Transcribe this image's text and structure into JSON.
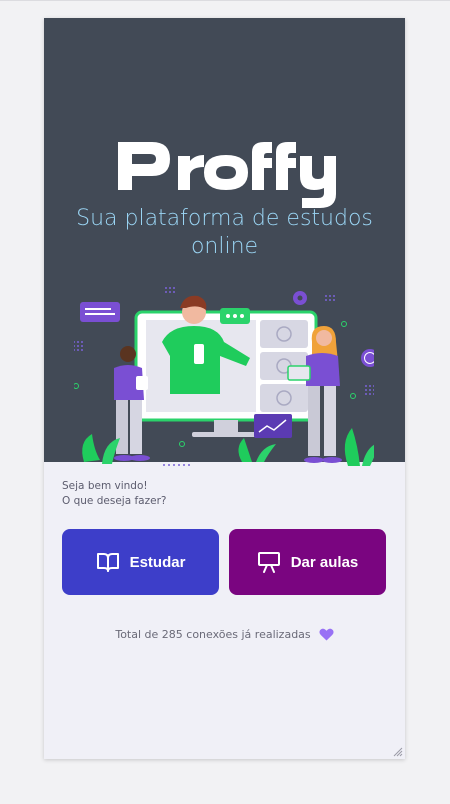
{
  "app": {
    "logo_text": "Proffy",
    "tagline_line1": "Sua plataforma de estudos",
    "tagline_line2": "online"
  },
  "welcome": {
    "line1": "Seja bem vindo!",
    "line2": "O que deseja fazer?"
  },
  "actions": {
    "study_label": "Estudar",
    "study_icon": "book-open-icon",
    "teach_label": "Dar aulas",
    "teach_icon": "presentation-icon"
  },
  "footer": {
    "total_text": "Total de 285 conexões já realizadas",
    "heart_icon": "heart-icon"
  },
  "colors": {
    "hero_bg": "#424a56",
    "tagline": "#9bd6f5",
    "study_button": "#3d3ec9",
    "teach_button": "#7a0580",
    "heart": "#9871f5"
  }
}
